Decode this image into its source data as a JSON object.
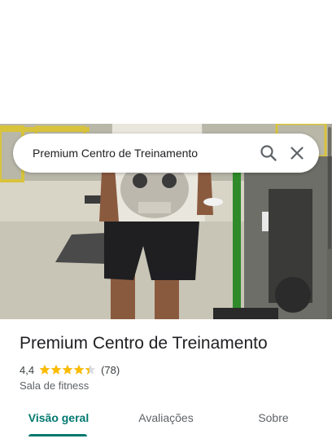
{
  "search": {
    "query": "Premium Centro de Treinamento"
  },
  "place": {
    "name": "Premium Centro de Treinamento",
    "rating": "4,4",
    "rating_value": 4.4,
    "review_count": "(78)",
    "category": "Sala de fitness"
  },
  "tabs": [
    {
      "label": "Visão geral",
      "active": true
    },
    {
      "label": "Avaliações",
      "active": false
    },
    {
      "label": "Sobre",
      "active": false
    }
  ],
  "colors": {
    "accent": "#01786f",
    "star": "#fbbc04",
    "text_primary": "#202124",
    "text_secondary": "#5f6368"
  },
  "icons": {
    "search": "search-icon",
    "close": "close-icon",
    "star": "star-icon"
  }
}
